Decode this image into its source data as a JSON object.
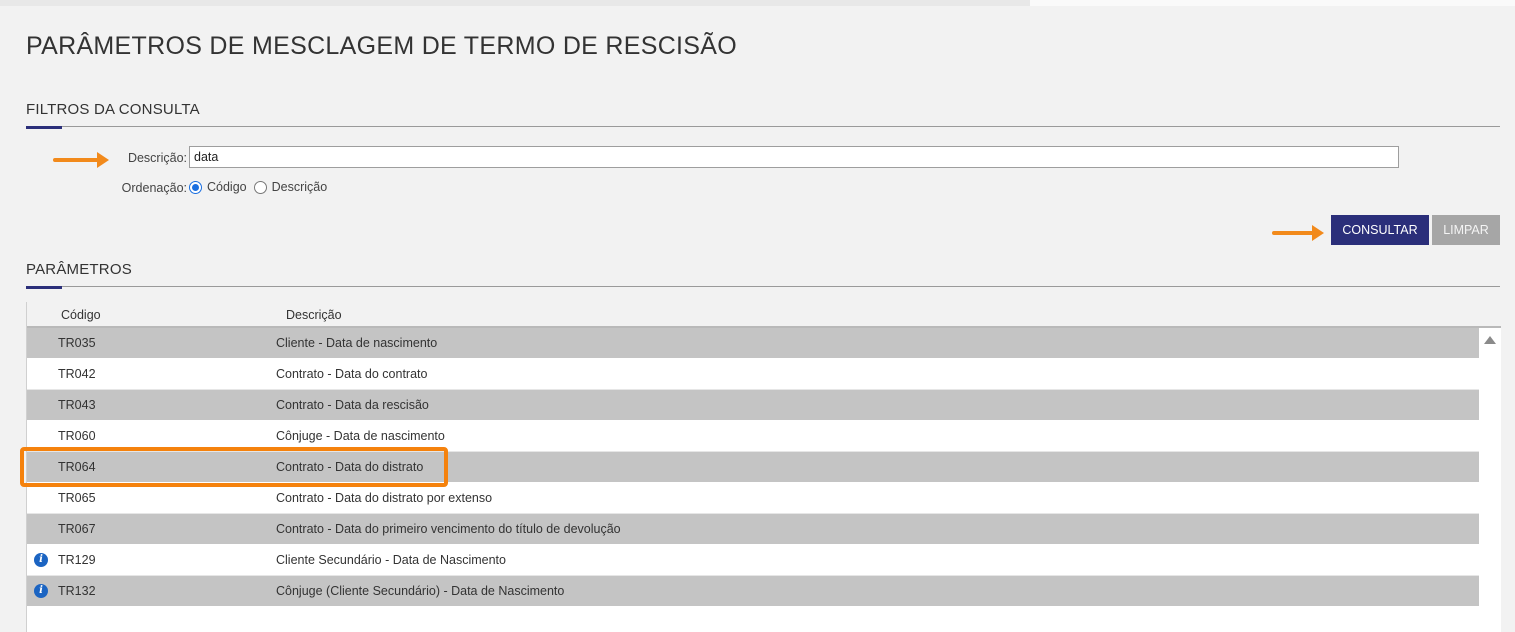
{
  "page": {
    "title": "PARÂMETROS DE MESCLAGEM DE TERMO DE RESCISÃO"
  },
  "filters": {
    "section_title": "FILTROS DA CONSULTA",
    "description_label": "Descrição:",
    "description_value": "data",
    "order_label": "Ordenação:",
    "order_options": [
      {
        "label": "Código",
        "selected": true
      },
      {
        "label": "Descrição",
        "selected": false
      }
    ],
    "consult_button": "CONSULTAR",
    "clear_button": "LIMPAR"
  },
  "parameters": {
    "section_title": "PARÂMETROS",
    "columns": [
      "Código",
      "Descrição"
    ],
    "rows": [
      {
        "code": "TR035",
        "description": "Cliente - Data de nascimento",
        "info": false
      },
      {
        "code": "TR042",
        "description": "Contrato - Data do contrato",
        "info": false
      },
      {
        "code": "TR043",
        "description": "Contrato - Data da rescisão",
        "info": false
      },
      {
        "code": "TR060",
        "description": "Cônjuge - Data de nascimento",
        "info": false
      },
      {
        "code": "TR064",
        "description": "Contrato - Data do distrato",
        "info": false
      },
      {
        "code": "TR065",
        "description": "Contrato - Data do distrato por extenso",
        "info": false
      },
      {
        "code": "TR067",
        "description": "Contrato - Data do primeiro vencimento do título de devolução",
        "info": false
      },
      {
        "code": "TR129",
        "description": "Cliente Secundário - Data de Nascimento",
        "info": true
      },
      {
        "code": "TR132",
        "description": "Cônjuge (Cliente Secundário) - Data de Nascimento",
        "info": true
      }
    ],
    "highlighted_code": "TR064"
  },
  "colors": {
    "primary": "#2b2f7a",
    "annotation": "#f28a1b",
    "info_icon": "#1b64c2",
    "row_shaded": "#c4c4c4"
  },
  "icons": {
    "row_info": "info-icon",
    "scroll_up": "scroll-up-icon",
    "annotation": "arrow-right-icon"
  }
}
